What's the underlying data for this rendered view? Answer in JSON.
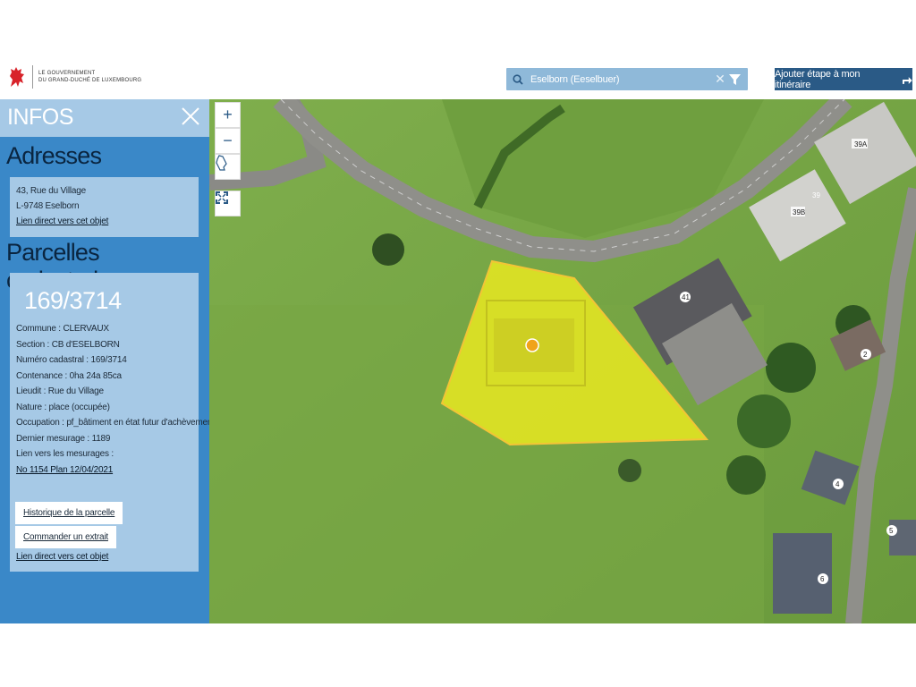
{
  "header": {
    "gov_line1": "LE GOUVERNEMENT",
    "gov_line2": "DU GRAND-DUCHÉ DE LUXEMBOURG",
    "search_value": "Eselborn (Eeselbuer)",
    "route_button": "Ajouter étape à mon itinéraire",
    "clear_glyph": "✕",
    "icons": [
      "lion-crest-icon",
      "search-icon",
      "clear-icon",
      "filter-funnel-icon",
      "route-arrow-icon"
    ]
  },
  "panel": {
    "title": "INFOS",
    "addresses": {
      "heading": "Adresses",
      "line1": "43, Rue du Village",
      "line2": "L-9748 Eselborn",
      "link": "Lien direct vers cet objet"
    },
    "parcels": {
      "heading": "Parcelles cadastrales",
      "number": "169/3714",
      "commune": "Commune : CLERVAUX",
      "section": "Section : CB d'ESELBORN",
      "cadastral": "Numéro cadastral : 169/3714",
      "contenance": "Contenance : 0ha 24a 85ca",
      "lieudit": "Lieudit : Rue du Village",
      "nature": "Nature : place (occupée)",
      "occupation": "Occupation : pf_bâtiment en état futur d'achèvement",
      "mesurage": "Dernier mesurage : 1189",
      "mesurages_label": "Lien vers les mesurages :",
      "mesurages_link": "No 1154 Plan 12/04/2021",
      "history_button": "Historique de la parcelle",
      "order_button": "Commander un extrait",
      "link": "Lien direct vers cet objet"
    }
  },
  "map": {
    "controls": {
      "zoom_in": "+",
      "zoom_out": "−"
    },
    "house_numbers": [
      "39A",
      "39",
      "39B",
      "41",
      "2",
      "4",
      "5",
      "6"
    ],
    "highlight_color": "#f2ee1e",
    "accent_color": "#2a5a86"
  }
}
